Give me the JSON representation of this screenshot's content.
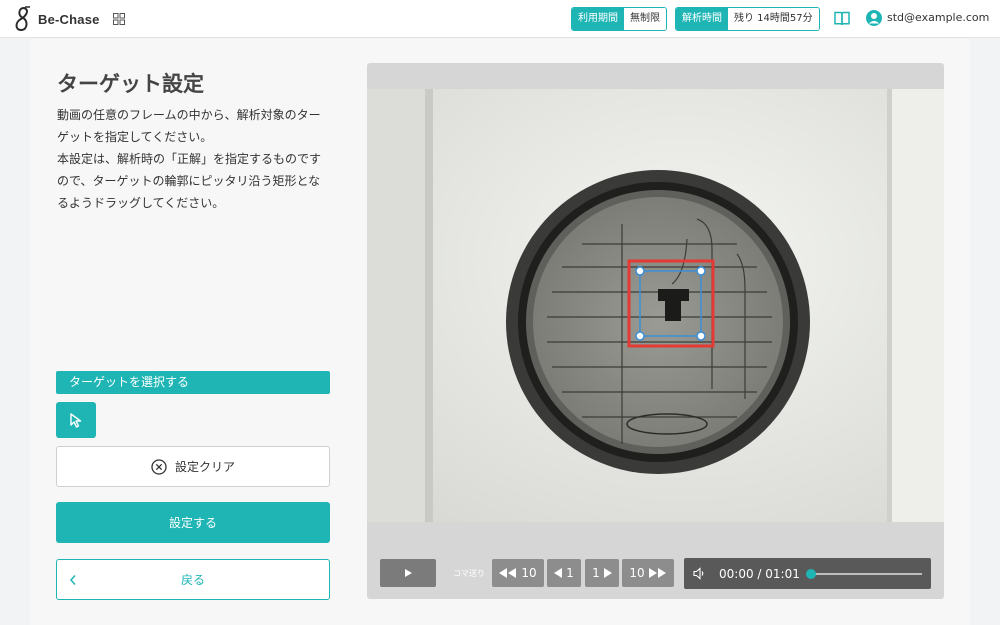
{
  "header": {
    "brand": "Be-Chase",
    "usage_period_label": "利用期間",
    "usage_period_value": "無制限",
    "analysis_time_label": "解析時間",
    "analysis_time_value": "残り 14時間57分",
    "user_email": "std@example.com"
  },
  "panel": {
    "title": "ターゲット設定",
    "description_lines": [
      "動画の任意のフレームの中から、解析対象のターゲットを指定してください。",
      "本設定は、解析時の「正解」を指定するものですので、ターゲットの輪郭にピッタリ沿う矩形となるようドラッグしてください。"
    ],
    "select_section_label": "ターゲットを選択する",
    "clear_button": "設定クリア",
    "set_button": "設定する",
    "back_button": "戻る"
  },
  "player": {
    "frame_step_label": "コマ送り",
    "back10_label": "10",
    "back1_label": "1",
    "fwd1_label": "1",
    "fwd10_label": "10",
    "time": "00:00 / 01:01",
    "progress": 0.0
  },
  "colors": {
    "accent": "#1fb5b5",
    "ground_truth_box": "#e53935",
    "selection_box": "#3b8fd6"
  },
  "icons": [
    "logo-mark",
    "grid-icon",
    "book-icon",
    "user-icon",
    "cursor-icon",
    "clear-icon",
    "chevron-left-icon",
    "play-icon",
    "volume-icon"
  ]
}
